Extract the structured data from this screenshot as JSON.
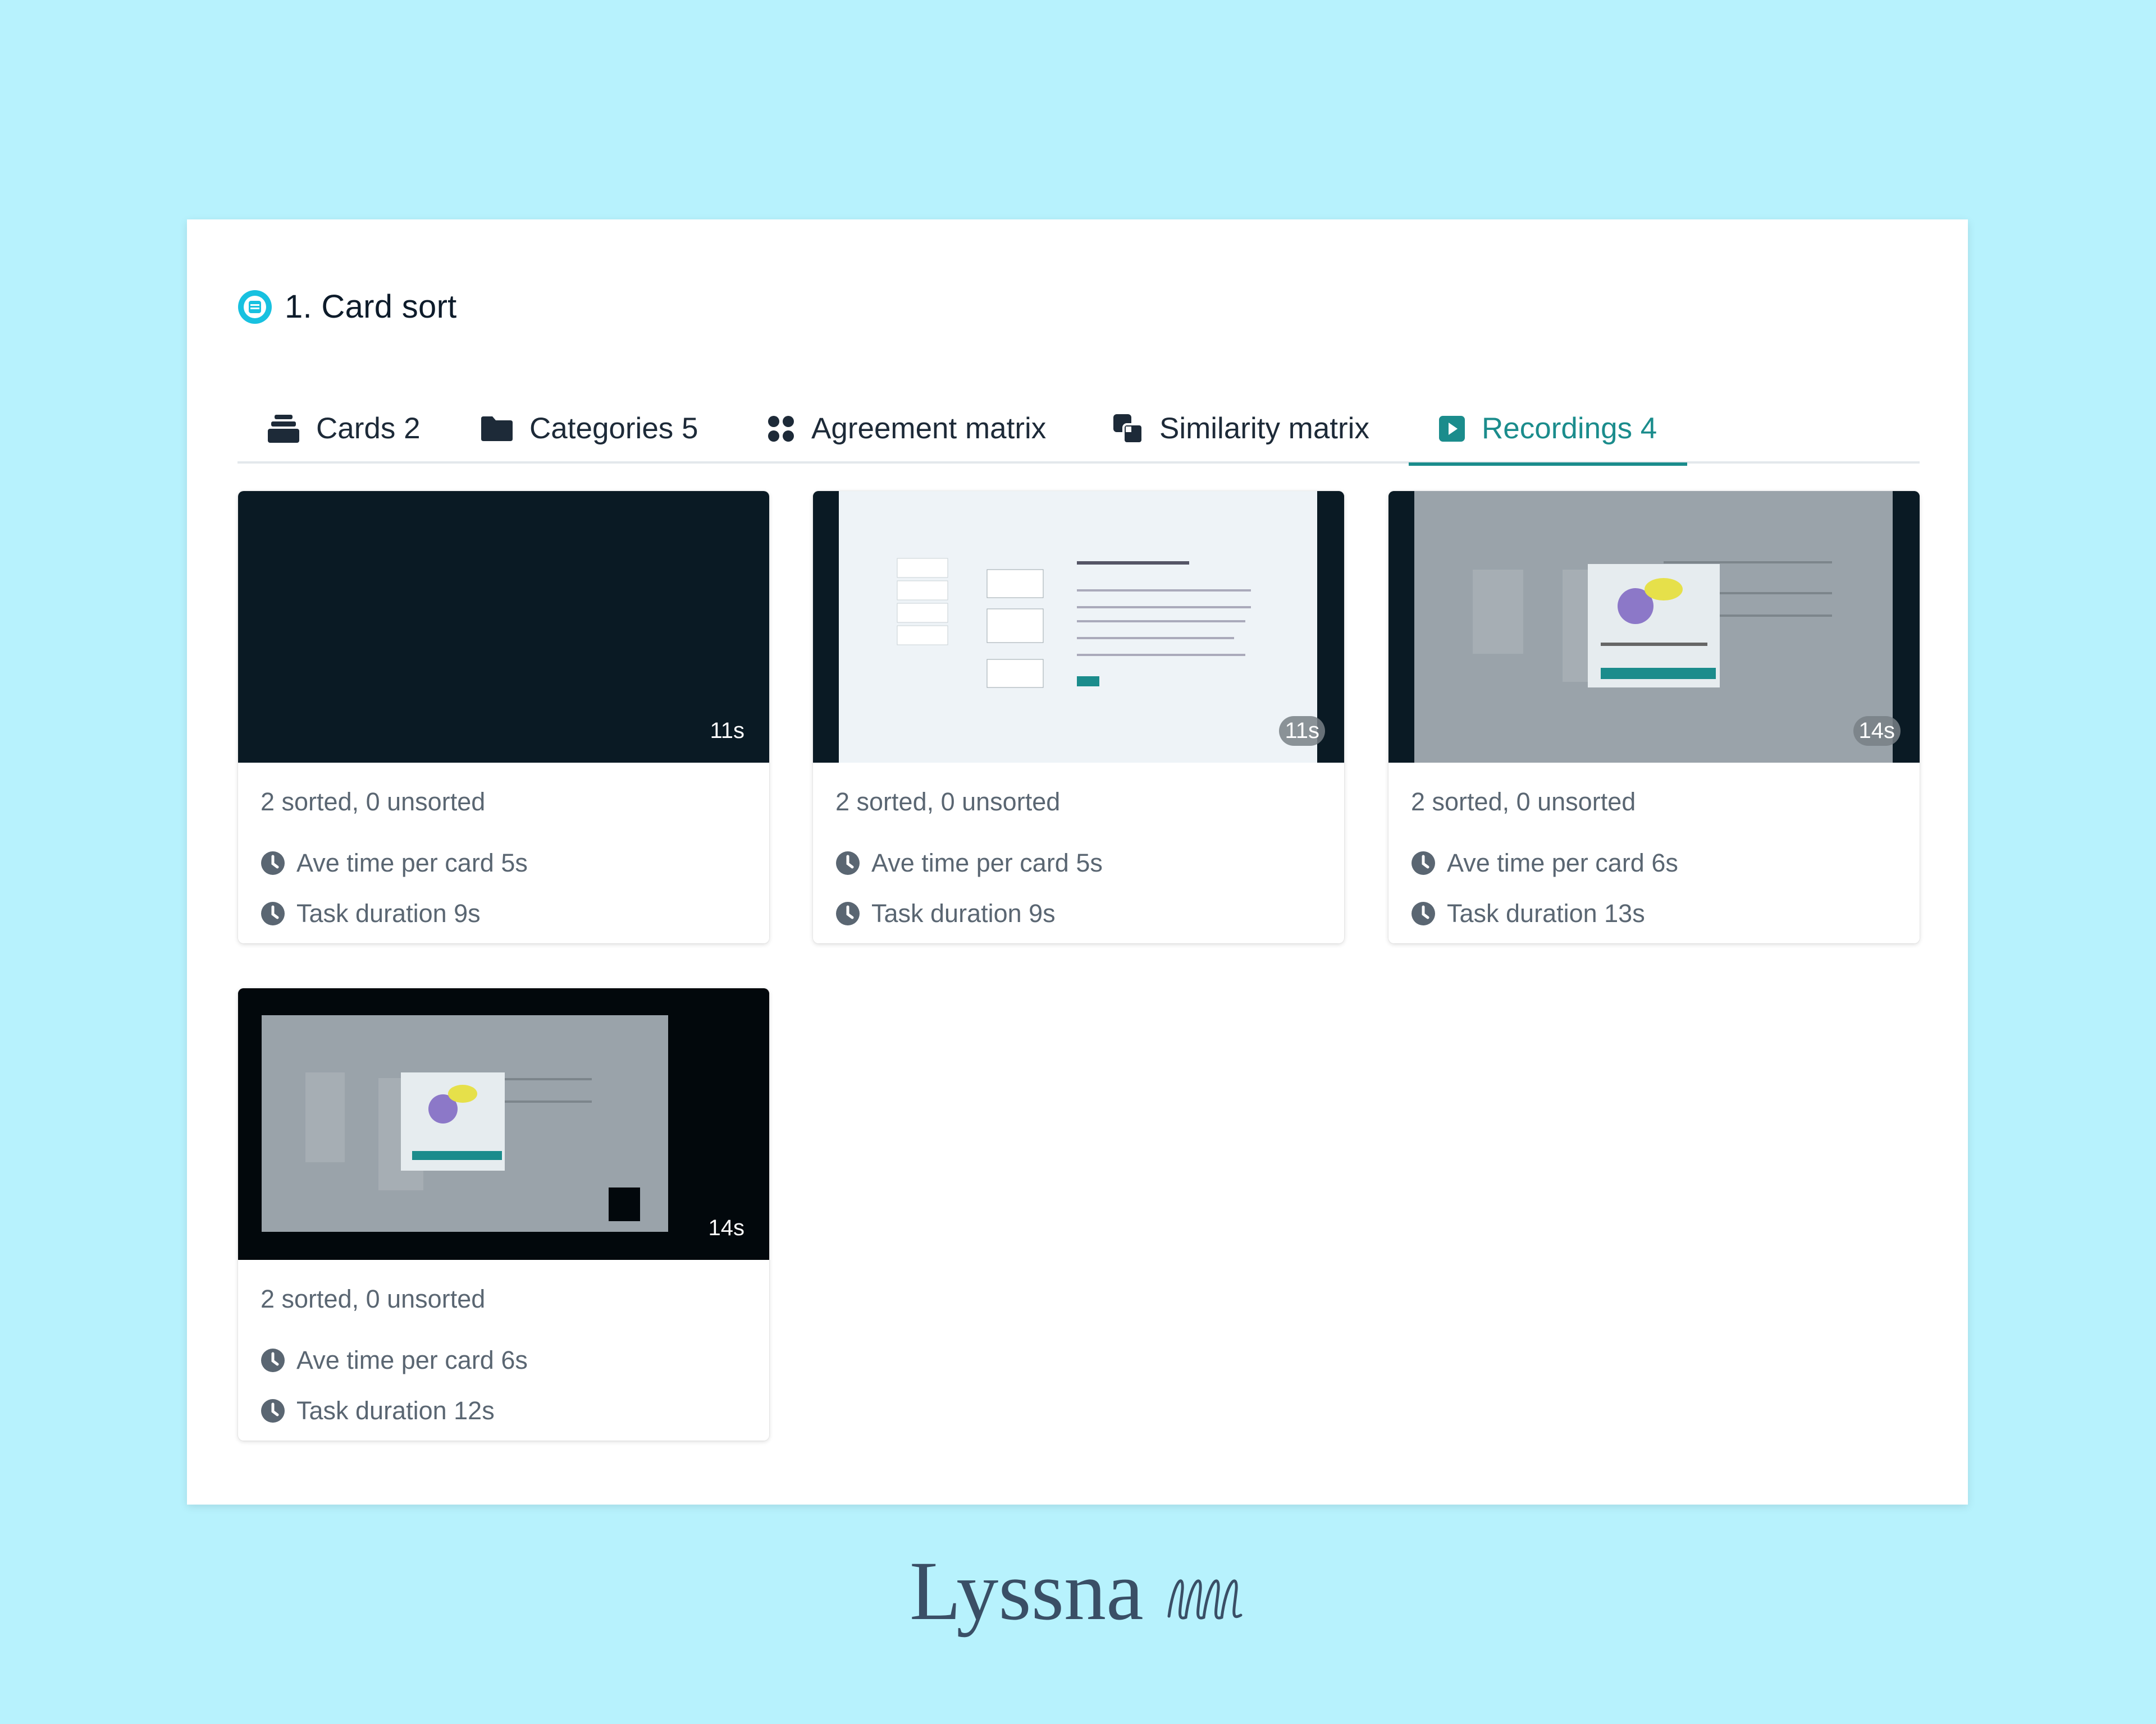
{
  "section": {
    "title": "1. Card sort",
    "icon": "card-sort-icon",
    "icon_color": "#18c1e0"
  },
  "tabs": [
    {
      "label": "Cards 2",
      "icon": "cards-stack-icon",
      "active": false
    },
    {
      "label": "Categories 5",
      "icon": "folder-icon",
      "active": false
    },
    {
      "label": "Agreement matrix",
      "icon": "grid-dots-icon",
      "active": false
    },
    {
      "label": "Similarity matrix",
      "icon": "overlap-squares-icon",
      "active": false
    },
    {
      "label": "Recordings 4",
      "icon": "play-square-icon",
      "active": true
    }
  ],
  "recordings": [
    {
      "duration_badge": "11s",
      "sorted": "2 sorted, 0 unsorted",
      "ave_time": "Ave time per card 5s",
      "task_duration": "Task duration 9s"
    },
    {
      "duration_badge": "11s",
      "sorted": "2 sorted, 0 unsorted",
      "ave_time": "Ave time per card 5s",
      "task_duration": "Task duration 9s"
    },
    {
      "duration_badge": "14s",
      "sorted": "2 sorted, 0 unsorted",
      "ave_time": "Ave time per card 6s",
      "task_duration": "Task duration 13s"
    },
    {
      "duration_badge": "14s",
      "sorted": "2 sorted, 0 unsorted",
      "ave_time": "Ave time per card 6s",
      "task_duration": "Task duration 12s"
    }
  ],
  "brand": {
    "name": "Lyssna",
    "color": "#3a4f66"
  },
  "colors": {
    "accent": "#1b8c8c",
    "background": "#b7f2fd",
    "text_muted": "#5a6672"
  }
}
